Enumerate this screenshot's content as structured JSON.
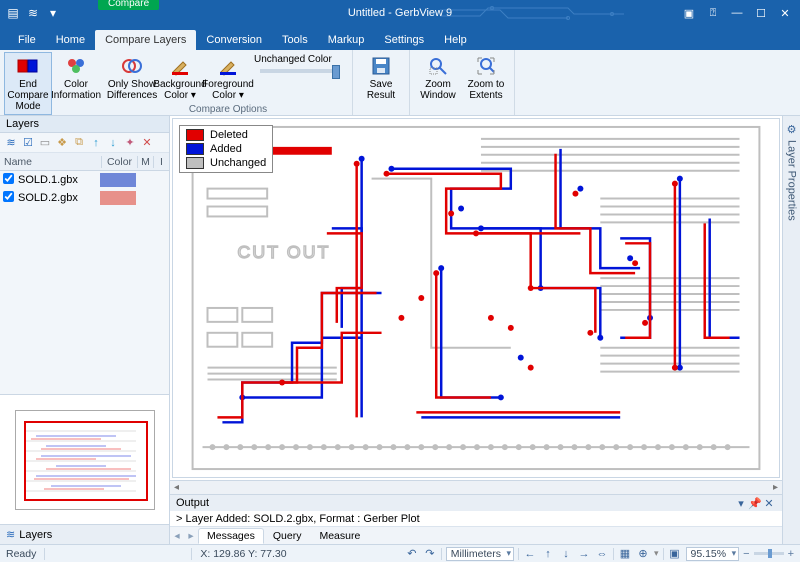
{
  "title": "Untitled - GerbView 9",
  "ribbon_context": "Compare",
  "tabs": [
    "File",
    "Home",
    "Compare Layers",
    "Conversion",
    "Tools",
    "Markup",
    "Settings",
    "Help"
  ],
  "active_tab": "Compare Layers",
  "ribbon": {
    "end_compare": "End Compare Mode",
    "color_info": "Color Information",
    "only_show": "Only Show Differences",
    "bg_color": "Background Color ▾",
    "fg_color": "Foreground Color ▾",
    "unchanged_color": "Unchanged Color",
    "group_compare": "Compare Options",
    "save_result": "Save Result",
    "zoom_window": "Zoom Window",
    "zoom_extents": "Zoom to Extents"
  },
  "layers_panel": {
    "title": "Layers",
    "columns": {
      "name": "Name",
      "color": "Color",
      "m": "M",
      "i": "I"
    },
    "rows": [
      {
        "checked": true,
        "name": "SOLD.1.gbx",
        "color": "#6f87d8"
      },
      {
        "checked": true,
        "name": "SOLD.2.gbx",
        "color": "#e7918a"
      }
    ],
    "footer": "Layers"
  },
  "legend": [
    {
      "label": "Deleted",
      "color": "#e10000"
    },
    {
      "label": "Added",
      "color": "#0014d8"
    },
    {
      "label": "Unchanged",
      "color": "#bfbfbf"
    }
  ],
  "right_panel": "Layer Properties",
  "output": {
    "title": "Output",
    "line": "> Layer Added: SOLD.2.gbx, Format : Gerber Plot",
    "tabs": [
      "Messages",
      "Query",
      "Measure"
    ],
    "active": "Messages"
  },
  "status": {
    "ready": "Ready",
    "coords": "X: 129.86    Y: 77.30",
    "units": "Millimeters",
    "zoom": "95.15%"
  }
}
